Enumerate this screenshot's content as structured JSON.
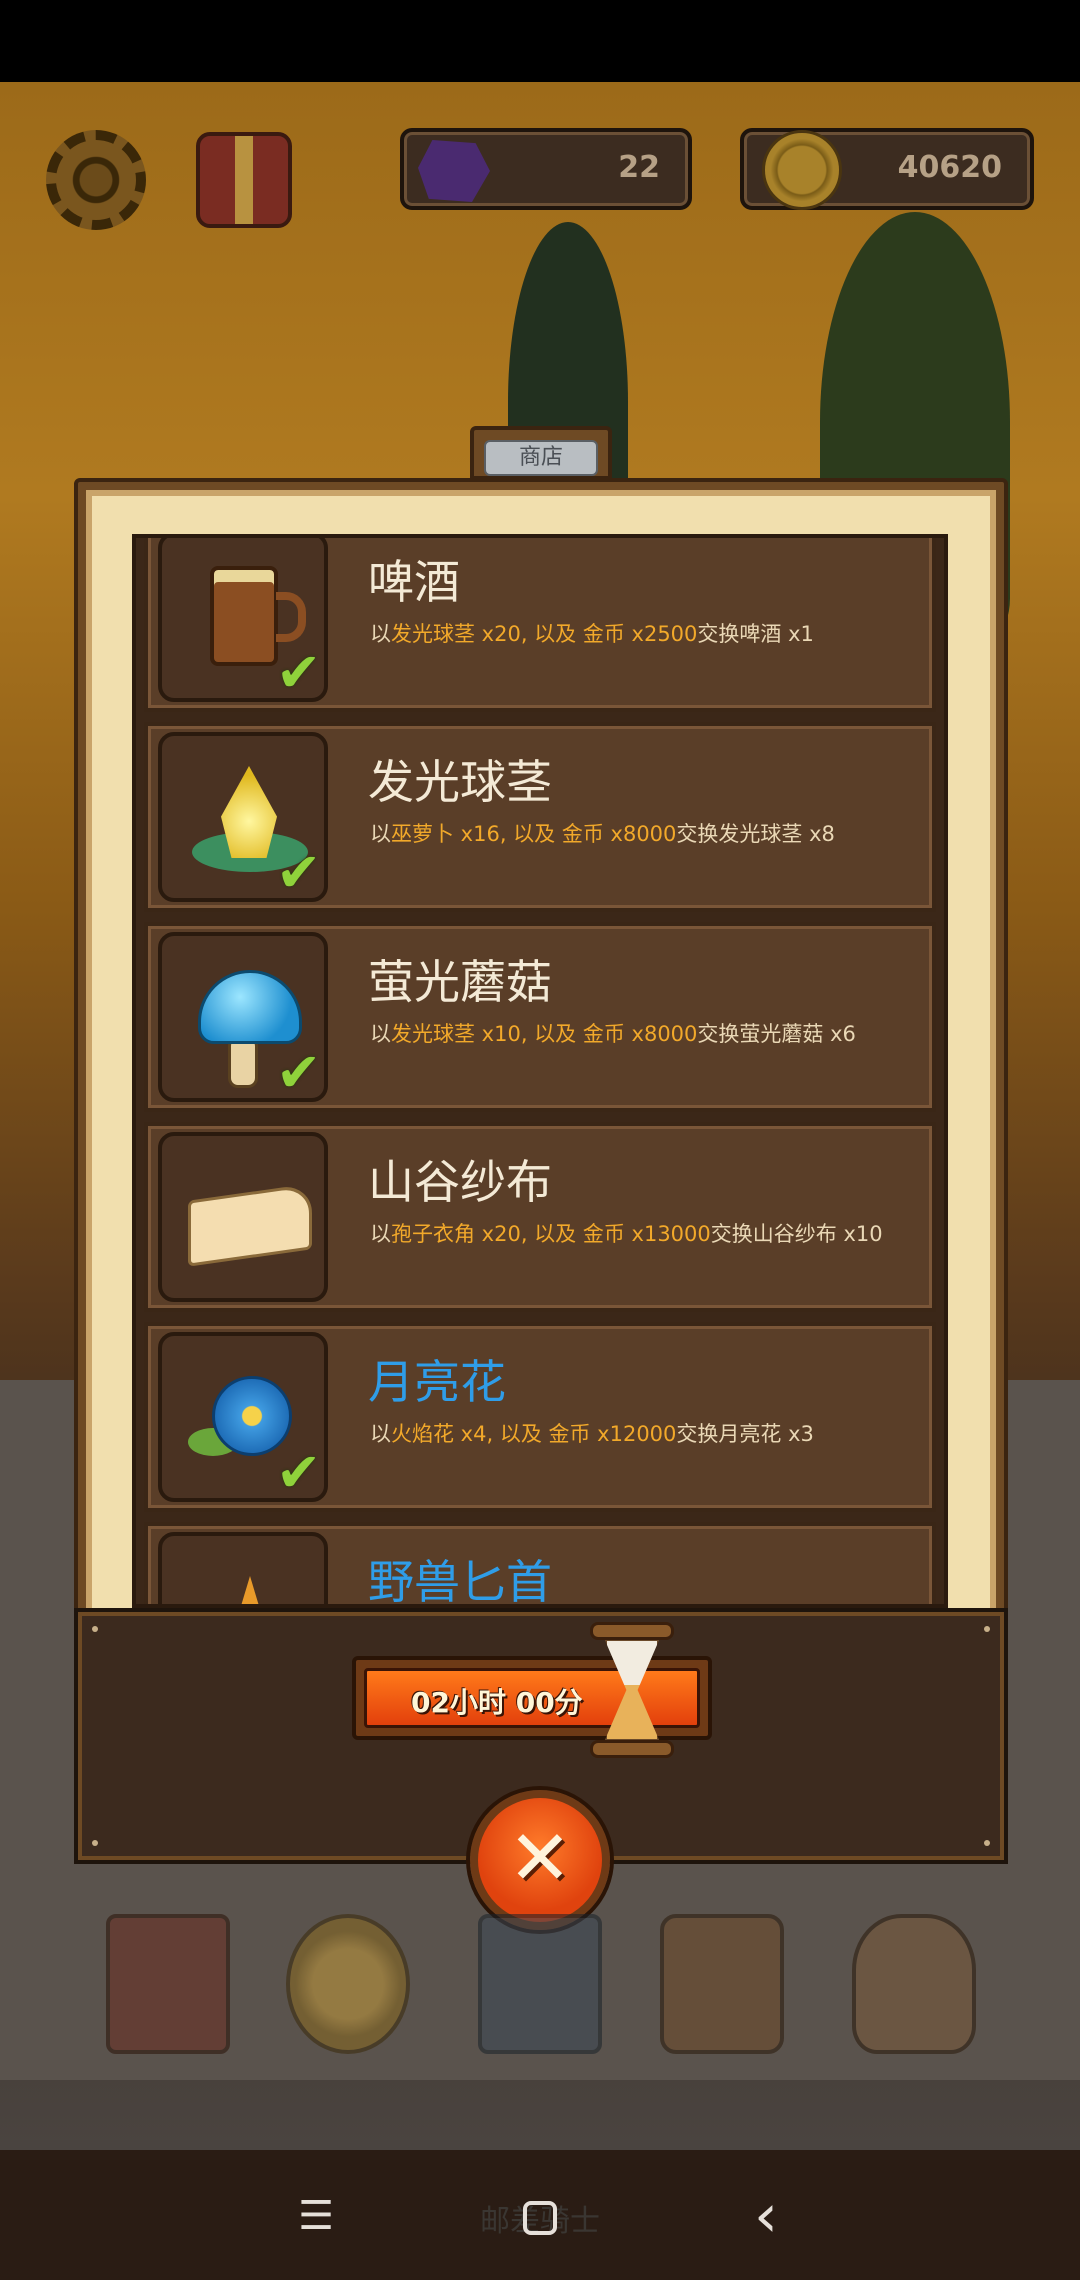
{
  "hud": {
    "gems": "22",
    "coins": "40620"
  },
  "shop": {
    "title": "商店",
    "items": [
      {
        "name": "啤酒",
        "desc_prefix": "以",
        "ingredient": "发光球茎 x20, 以及 金币 x2500",
        "desc_suffix": "交换啤酒 x1",
        "owned": true,
        "name_color": "#f4ead6"
      },
      {
        "name": "发光球茎",
        "desc_prefix": "以",
        "ingredient": "巫萝卜 x16, 以及 金币 x8000",
        "desc_suffix": "交换发光球茎 x8",
        "owned": true,
        "name_color": "#f4ead6"
      },
      {
        "name": "萤光蘑菇",
        "desc_prefix": "以",
        "ingredient": "发光球茎 x10, 以及 金币 x8000",
        "desc_suffix": "交换萤光蘑菇 x6",
        "owned": true,
        "name_color": "#f4ead6"
      },
      {
        "name": "山谷纱布",
        "desc_prefix": "以",
        "ingredient": "孢子衣角 x20, 以及 金币 x13000",
        "desc_suffix": "交换山谷纱布 x10",
        "owned": false,
        "name_color": "#f4ead6"
      },
      {
        "name": "月亮花",
        "desc_prefix": "以",
        "ingredient": "火焰花 x4, 以及 金币 x12000",
        "desc_suffix": "交换月亮花 x3",
        "owned": true,
        "name_color": "#2f9de8"
      },
      {
        "name": "野兽匕首",
        "name_color": "#2f9de8"
      }
    ],
    "timer": "02小时 00分",
    "close_symbol": "✕"
  },
  "dock": {
    "label": "邮差骑士"
  },
  "navbar": {
    "menu": "☰",
    "back": "‹"
  }
}
